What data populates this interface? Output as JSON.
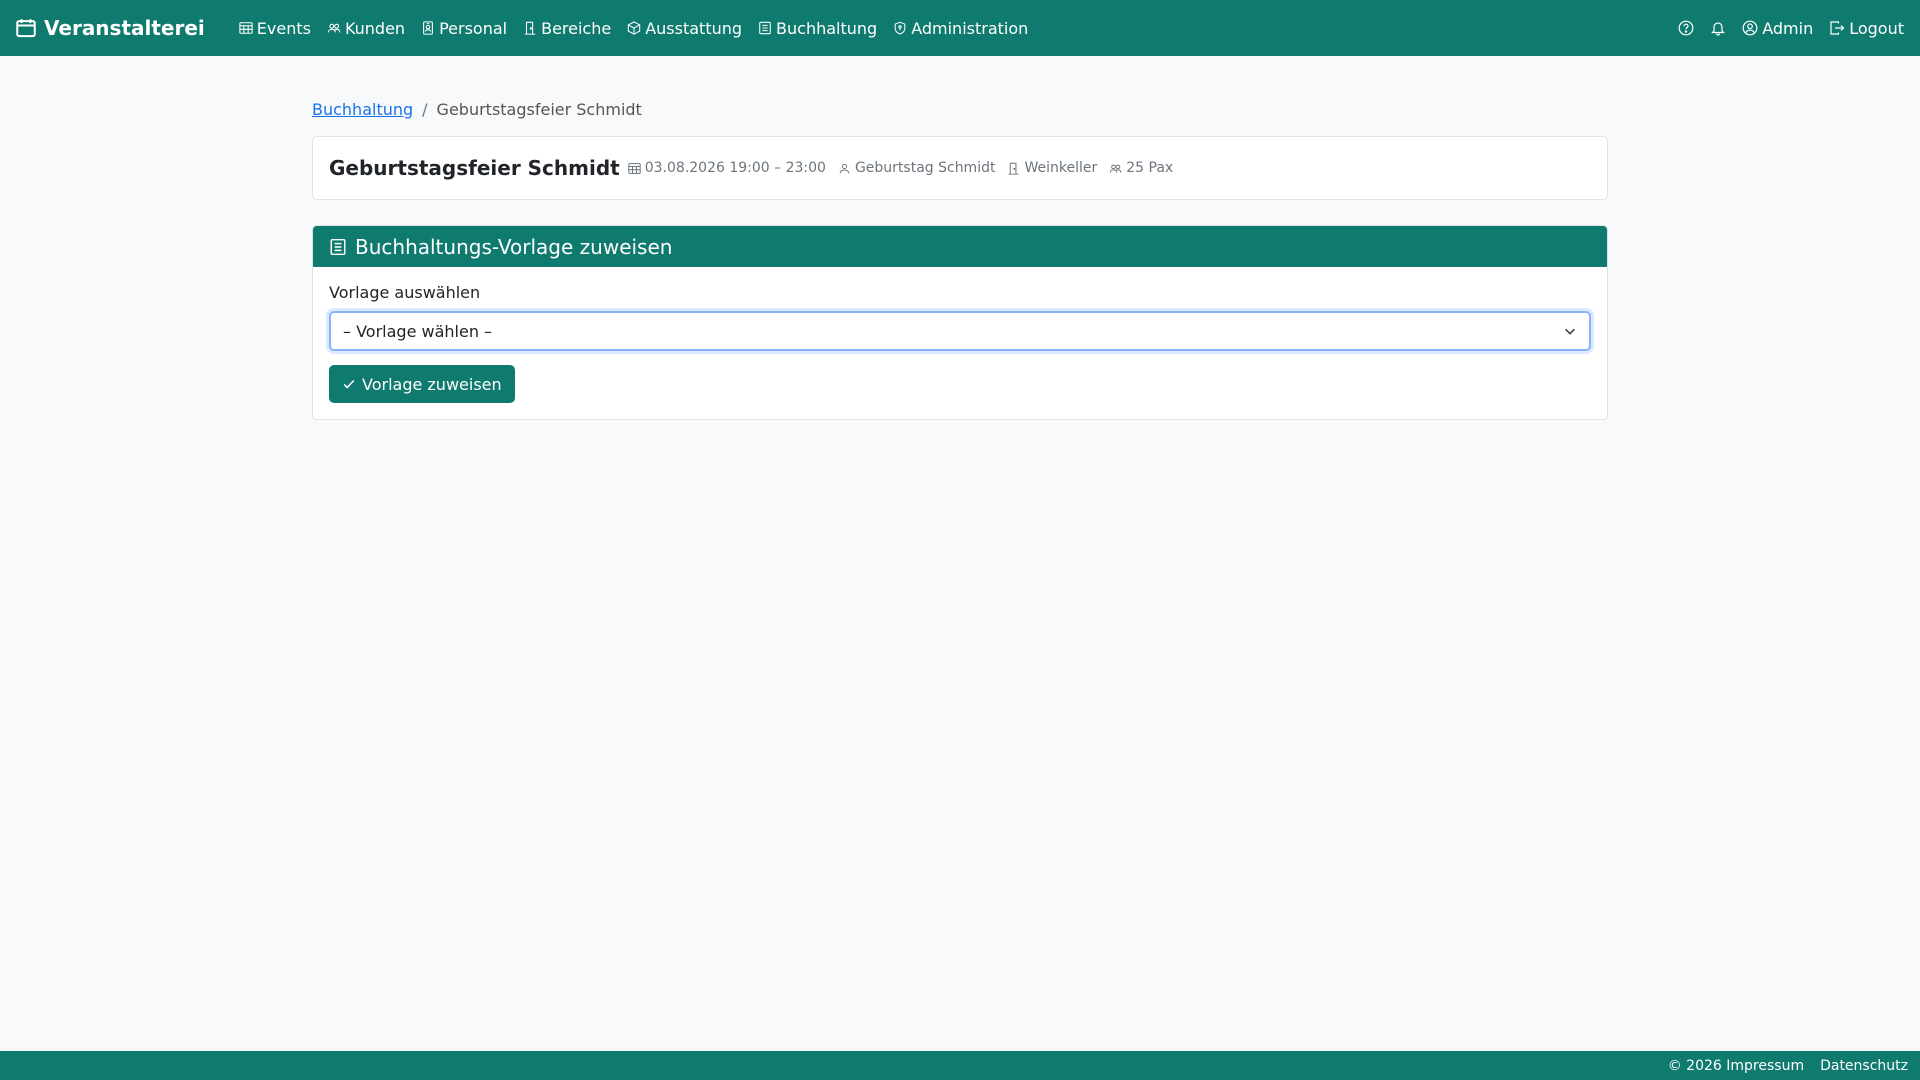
{
  "topbar": {
    "brand": "Veranstalterei",
    "nav": [
      {
        "label": "Events",
        "icon": "calendar-table-icon"
      },
      {
        "label": "Kunden",
        "icon": "people-icon"
      },
      {
        "label": "Personal",
        "icon": "badge-icon"
      },
      {
        "label": "Bereiche",
        "icon": "door-icon"
      },
      {
        "label": "Ausstattung",
        "icon": "box-icon"
      },
      {
        "label": "Buchhaltung",
        "icon": "ledger-icon"
      },
      {
        "label": "Administration",
        "icon": "shield-icon"
      }
    ],
    "user": "Admin",
    "logout": "Logout"
  },
  "breadcrumb": {
    "parent": "Buchhaltung",
    "separator": "/",
    "current": "Geburtstagsfeier Schmidt"
  },
  "event": {
    "title": "Geburtstagsfeier Schmidt",
    "datetime": "03.08.2026 19:00 – 23:00",
    "customer": "Geburtstag Schmidt",
    "area": "Weinkeller",
    "pax": "25 Pax"
  },
  "assign": {
    "header": "Buchhaltungs-Vorlage zuweisen",
    "label": "Vorlage auswählen",
    "select_value": "– Vorlage wählen –",
    "button": "Vorlage zuweisen"
  },
  "footer": {
    "impressum": "© 2026 Impressum",
    "datenschutz": "Datenschutz"
  },
  "colors": {
    "brand": "#0f7a6e",
    "link": "#1a73e8"
  }
}
